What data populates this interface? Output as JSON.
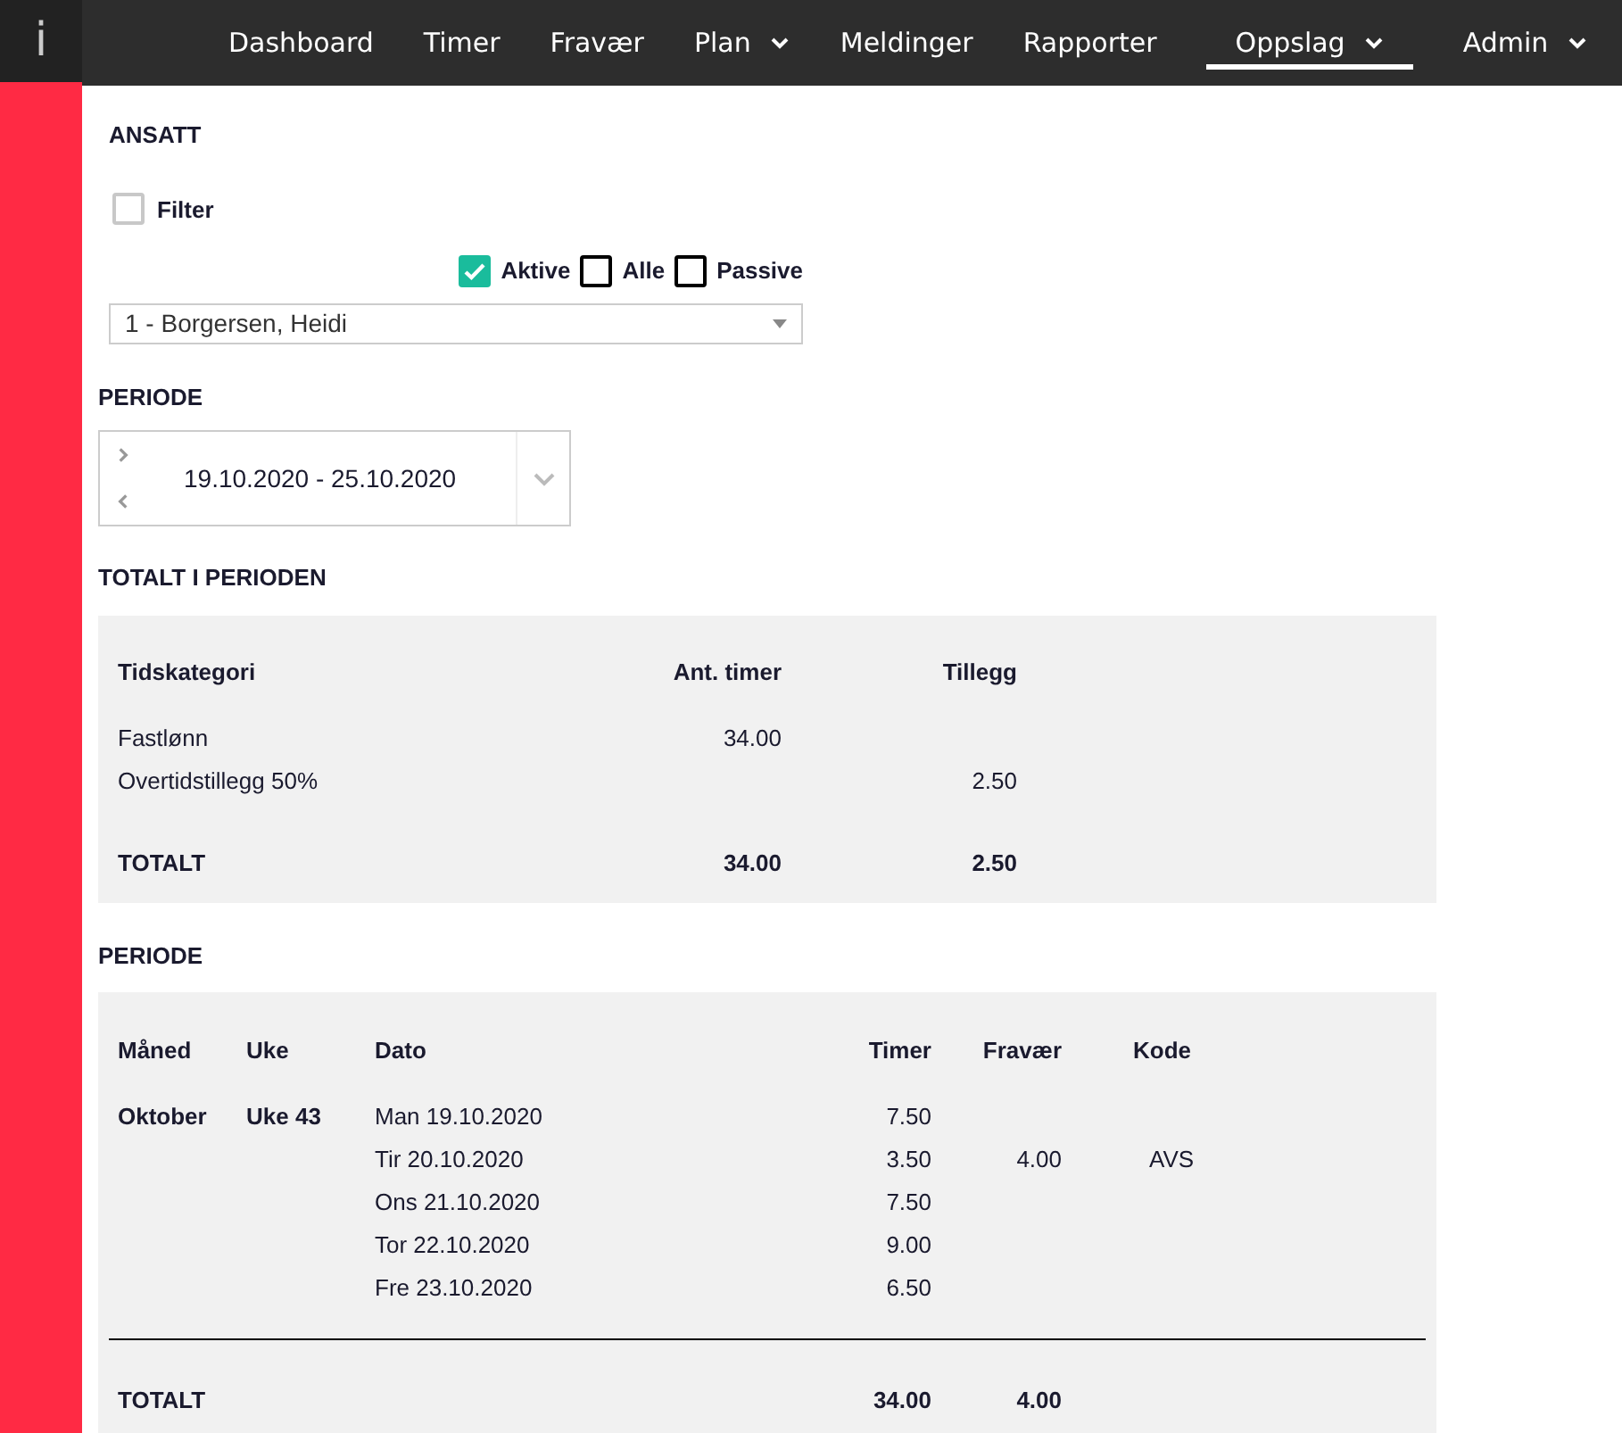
{
  "logo": "i",
  "nav": [
    {
      "label": "Dashboard",
      "dropdown": false,
      "selected": false
    },
    {
      "label": "Timer",
      "dropdown": false,
      "selected": false
    },
    {
      "label": "Fravær",
      "dropdown": false,
      "selected": false
    },
    {
      "label": "Plan",
      "dropdown": true,
      "selected": false
    },
    {
      "label": "Meldinger",
      "dropdown": false,
      "selected": false
    },
    {
      "label": "Rapporter",
      "dropdown": false,
      "selected": false
    },
    {
      "label": "Oppslag",
      "dropdown": true,
      "selected": true
    },
    {
      "label": "Admin",
      "dropdown": true,
      "selected": false
    }
  ],
  "employee": {
    "heading": "ANSATT",
    "filter": {
      "label": "Filter",
      "checked": false
    },
    "status_options": [
      {
        "label": "Aktive",
        "checked": true
      },
      {
        "label": "Alle",
        "checked": false
      },
      {
        "label": "Passive",
        "checked": false
      }
    ],
    "select_value": "1 - Borgersen, Heidi"
  },
  "period": {
    "heading": "PERIODE",
    "range": "19.10.2020 - 25.10.2020"
  },
  "summary": {
    "heading": "TOTALT I PERIODEN",
    "columns": [
      "Tidskategori",
      "Ant. timer",
      "Tillegg"
    ],
    "rows": [
      {
        "category": "Fastlønn",
        "hours": "34.00"
      },
      {
        "category": "Overtidstillegg 50%",
        "supplement": "2.50"
      }
    ],
    "total": {
      "label": "TOTALT",
      "hours": "34.00",
      "supplement": "2.50"
    }
  },
  "details": {
    "heading": "PERIODE",
    "columns": [
      "Måned",
      "Uke",
      "Dato",
      "Timer",
      "Fravær",
      "Kode"
    ],
    "month": "Oktober",
    "week": "Uke 43",
    "rows": [
      {
        "date": "Man 19.10.2020",
        "hours": "7.50"
      },
      {
        "date": "Tir 20.10.2020",
        "hours": "3.50",
        "absence": "4.00",
        "code": "AVS"
      },
      {
        "date": "Ons 21.10.2020",
        "hours": "7.50"
      },
      {
        "date": "Tor 22.10.2020",
        "hours": "9.00"
      },
      {
        "date": "Fre 23.10.2020",
        "hours": "6.50"
      }
    ],
    "total": {
      "label": "TOTALT",
      "hours": "34.00",
      "absence": "4.00"
    }
  }
}
